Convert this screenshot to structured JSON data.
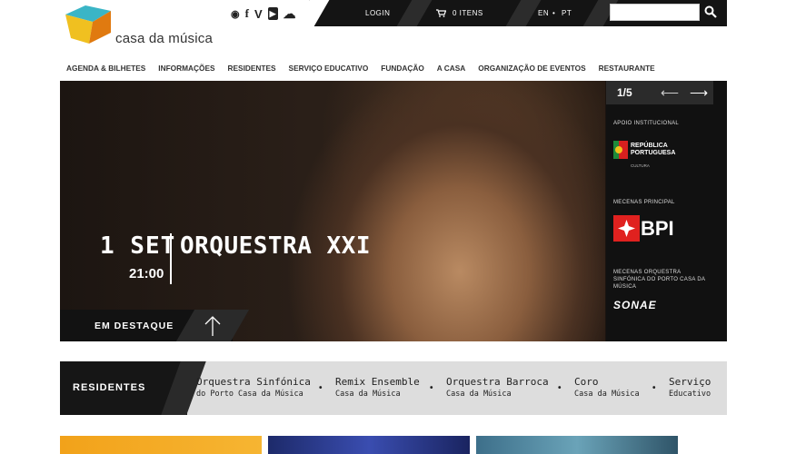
{
  "brand": {
    "name": "casa da música"
  },
  "social": [
    {
      "icon": "rss-icon",
      "glyph": "◉"
    },
    {
      "icon": "facebook-icon",
      "glyph": "f"
    },
    {
      "icon": "vimeo-icon",
      "glyph": "V"
    },
    {
      "icon": "youtube-icon",
      "glyph": "▶"
    },
    {
      "icon": "soundcloud-icon",
      "glyph": "☁"
    }
  ],
  "topbar": {
    "login": "LOGIN",
    "cart": "0 ITENS",
    "lang_en": "EN",
    "lang_sep": "•",
    "lang_pt": "PT",
    "search_placeholder": ""
  },
  "nav": [
    "AGENDA & BILHETES",
    "INFORMAÇÕES",
    "RESIDENTES",
    "SERVIÇO EDUCATIVO",
    "FUNDAÇÃO",
    "A CASA",
    "ORGANIZAÇÃO DE EVENTOS",
    "RESTAURANTE"
  ],
  "hero": {
    "day": "1 SET",
    "time": "21:00",
    "title": "ORQUESTRA XXI",
    "featured": "EM DESTAQUE",
    "pager": "1/5"
  },
  "sponsors": {
    "institutional_label": "APOIO INSTITUCIONAL",
    "republica_line1": "REPÚBLICA",
    "republica_line2": "PORTUGUESA",
    "republica_sub": "CULTURA",
    "main_label": "MECENAS PRINCIPAL",
    "bpi": "BPI",
    "orchestra_label": "MECENAS ORQUESTRA SINFÓNICA DO PORTO CASA DA MÚSICA",
    "sonae": "SONAE"
  },
  "residents": {
    "title": "RESIDENTES",
    "items": [
      {
        "a": "Orquestra Sinfónica",
        "b": "do Porto Casa da Música"
      },
      {
        "a": "Remix Ensemble",
        "b": "Casa da Música"
      },
      {
        "a": "Orquestra Barroca",
        "b": "Casa da Música"
      },
      {
        "a": "Coro",
        "b": "Casa da Música"
      },
      {
        "a": "Serviço",
        "b": "Educativo"
      }
    ]
  },
  "colors": {
    "accent": "#e0211f",
    "dark": "#141414",
    "logo_orange": "#f0a020",
    "logo_teal": "#3ab5c6"
  }
}
